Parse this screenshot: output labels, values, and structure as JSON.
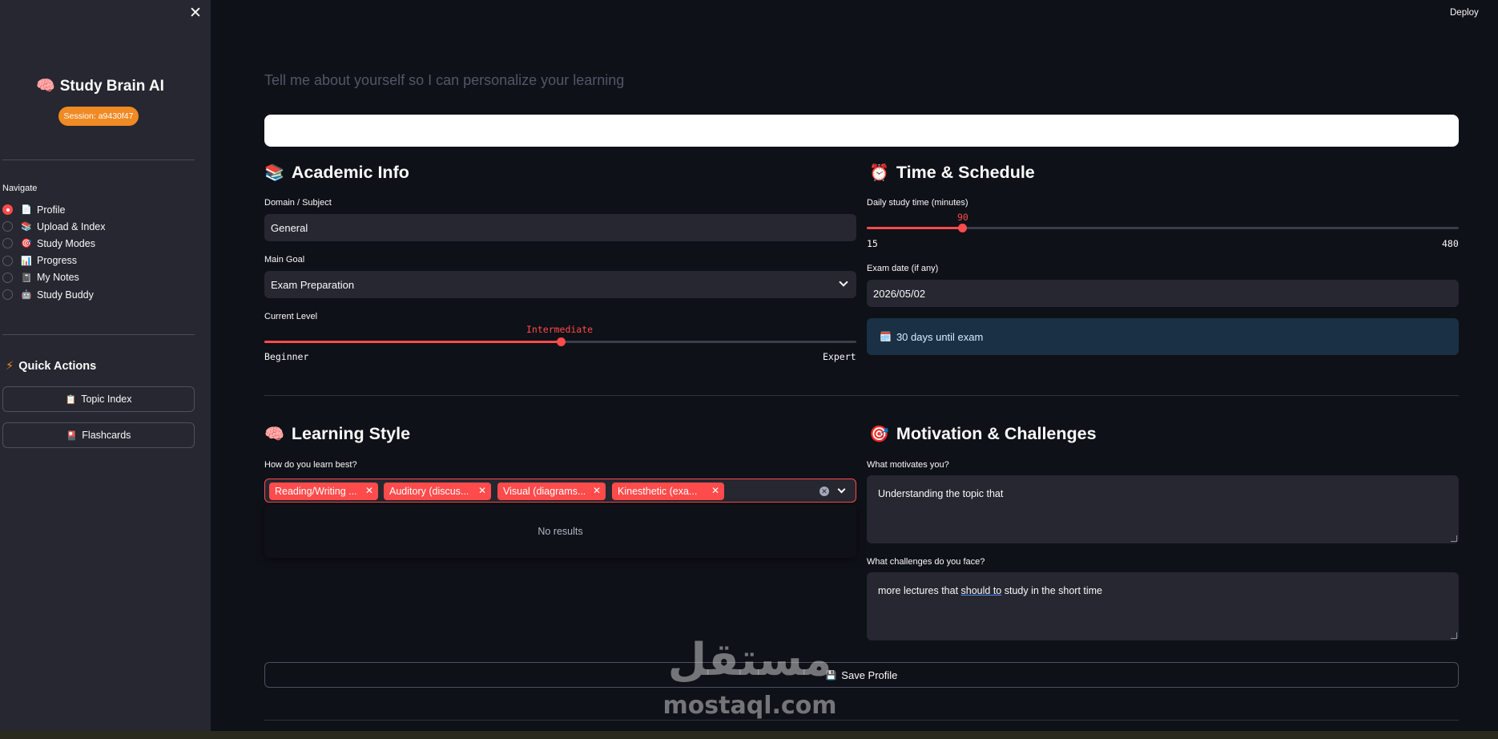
{
  "app": {
    "deploy_label": "Deploy",
    "close_glyph": "✕"
  },
  "sidebar": {
    "brand_emoji": "🧠",
    "brand_title": "Study Brain AI",
    "session_badge": "Session: a9430f47",
    "nav_label": "Navigate",
    "nav_items": [
      {
        "icon": "📄",
        "label": "Profile",
        "selected": true
      },
      {
        "icon": "📚",
        "label": "Upload & Index",
        "selected": false
      },
      {
        "icon": "🎯",
        "label": "Study Modes",
        "selected": false
      },
      {
        "icon": "📊",
        "label": "Progress",
        "selected": false
      },
      {
        "icon": "📓",
        "label": "My Notes",
        "selected": false
      },
      {
        "icon": "🤖",
        "label": "Study Buddy",
        "selected": false
      }
    ],
    "quick_actions_icon": "⚡",
    "quick_actions_title": "Quick Actions",
    "quick_buttons": [
      {
        "icon": "📋",
        "label": "Topic Index"
      },
      {
        "icon": "🎴",
        "label": "Flashcards"
      }
    ]
  },
  "main": {
    "subtitle": "Tell me about yourself so I can personalize your learning",
    "academic": {
      "emoji": "📚",
      "title": "Academic Info",
      "domain_label": "Domain / Subject",
      "domain_value": "General",
      "goal_label": "Main Goal",
      "goal_value": "Exam Preparation",
      "level_label": "Current Level",
      "level_value": "Intermediate",
      "level_min": "Beginner",
      "level_max": "Expert",
      "level_fraction": 0.5
    },
    "schedule": {
      "emoji": "⏰",
      "title": "Time & Schedule",
      "study_time_label": "Daily study time (minutes)",
      "study_time_value": "90",
      "study_time_min": "15",
      "study_time_max": "480",
      "study_time_numeric": 90,
      "study_time_min_numeric": 15,
      "study_time_max_numeric": 480,
      "exam_date_label": "Exam date (if any)",
      "exam_date_value": "2026/05/02",
      "info_emoji": "🗓️",
      "info_text": "30 days until exam"
    },
    "learning_style": {
      "emoji": "🧠",
      "title": "Learning Style",
      "question": "How do you learn best?",
      "tags": [
        "Reading/Writing ...",
        "Auditory (discus...",
        "Visual (diagrams...",
        "Kinesthetic (exa..."
      ],
      "no_results": "No results"
    },
    "motivation": {
      "emoji": "🎯",
      "title": "Motivation & Challenges",
      "motivates_label": "What motivates you?",
      "motivates_value": "Understanding the topic that",
      "challenges_label": "What challenges do you face?",
      "challenges_before": "more lectures that ",
      "challenges_underlined": "should to",
      "challenges_after": " study in the short time"
    },
    "save_emoji": "💾",
    "save_label": "Save Profile"
  },
  "watermark": {
    "arabic": "مستقل",
    "latin": "mostaql.com"
  },
  "colors": {
    "accent": "#ff4b4b",
    "session_badge": "#f08a24",
    "sidebar_bg": "#262730",
    "main_bg": "#0e1117",
    "info_bg": "#1a3044"
  }
}
